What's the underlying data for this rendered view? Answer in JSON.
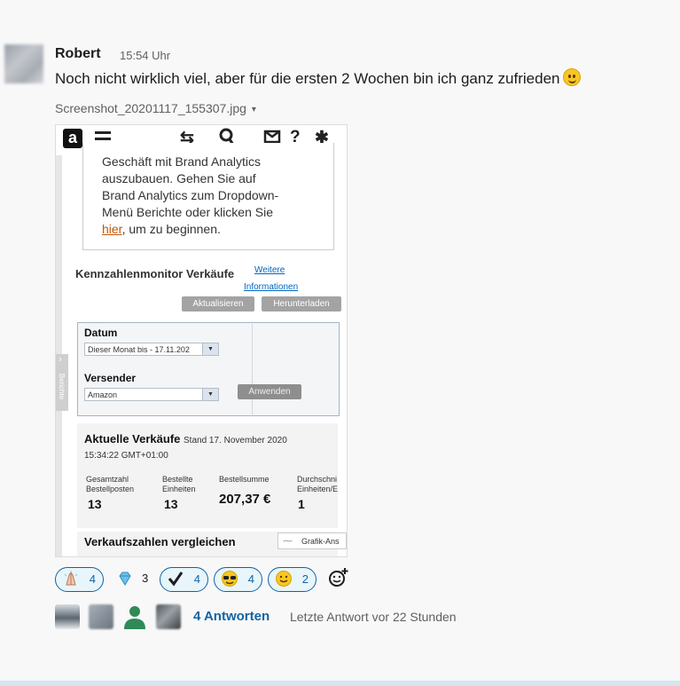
{
  "message": {
    "author": "Robert",
    "time": "15:54 Uhr",
    "text": "Noch nicht wirklich viel, aber für die ersten 2 Wochen bin ich ganz zufrieden",
    "attachment_name": "Screenshot_20201117_155307.jpg",
    "attachment_caret": "▾"
  },
  "screenshot": {
    "logo_letter": "a",
    "info_lines": [
      "Geschäft mit Brand Analytics",
      "auszubauen. Gehen Sie auf",
      "Brand Analytics zum Dropdown-",
      "Menü Berichte oder klicken Sie"
    ],
    "info_link": "hier",
    "info_tail": ", um zu beginnen.",
    "kpi_title": "Kennzahlenmonitor Verkäufe",
    "more_link_1": "Weitere",
    "more_link_2": "Informationen",
    "refresh_button": "Aktualisieren",
    "download_button": "Herunterladen",
    "side_tab": "Berichte",
    "date_label": "Datum",
    "date_value": "Dieser Monat bis - 17.11.202",
    "shipper_label": "Versender",
    "shipper_value": "Amazon",
    "apply_button": "Anwenden",
    "current_sales_title": "Aktuelle Verkäufe",
    "current_sales_stand": "Stand 17. November 2020",
    "current_sales_time": "15:34:22 GMT+01:00",
    "metrics": [
      {
        "label_1": "Gesamtzahl",
        "label_2": "Bestellposten",
        "value": "13"
      },
      {
        "label_1": "Bestellte",
        "label_2": "Einheiten",
        "value": "13"
      },
      {
        "label_1": "",
        "label_2": "Bestellsumme",
        "value": "207,37 €"
      },
      {
        "label_1": "Durchschni",
        "label_2": "Einheiten/E",
        "value": "1"
      }
    ],
    "compare_title": "Verkaufszahlen vergleichen",
    "chart_button": "Grafik-Ans"
  },
  "reactions": [
    {
      "emoji": "pray",
      "count": "4",
      "selected": true
    },
    {
      "emoji": "gem",
      "count": "3",
      "selected": false
    },
    {
      "emoji": "heavy-check",
      "count": "4",
      "selected": true
    },
    {
      "emoji": "sunglasses",
      "count": "4",
      "selected": true
    },
    {
      "emoji": "slightly-smiling",
      "count": "2",
      "selected": true
    }
  ],
  "thread": {
    "replies": "4 Antworten",
    "last_reply": "Letzte Antwort vor 22 Stunden"
  },
  "colors": {
    "link": "#1264a3",
    "reaction_bg": "#e8f5fa",
    "amazon_link": "#c45500"
  }
}
